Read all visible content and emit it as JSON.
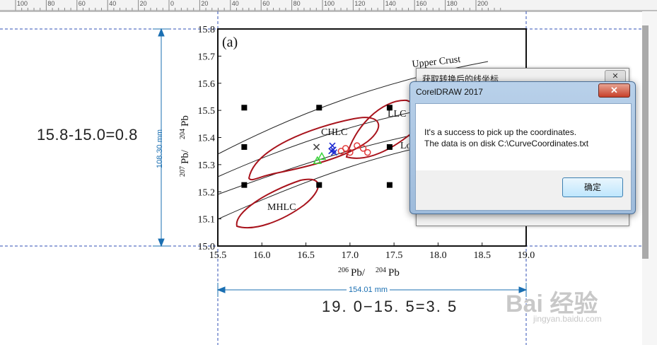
{
  "ruler": {
    "ticks": [
      "100",
      "80",
      "60",
      "40",
      "20",
      "0",
      "20",
      "40",
      "60",
      "80",
      "100",
      "120",
      "140",
      "160",
      "180",
      "200"
    ]
  },
  "chart_data": {
    "type": "scatter",
    "panel_label": "(a)",
    "xlabel_main": "Pb/",
    "xlabel_sup1": "206",
    "xlabel_sup2": "204",
    "xlabel_end": "Pb",
    "ylabel_main": "Pb/",
    "ylabel_sup1": "207",
    "ylabel_sup2": "204",
    "ylabel_end": "Pb",
    "xlim": [
      15.5,
      19.0
    ],
    "ylim": [
      15.0,
      15.8
    ],
    "xticks": [
      "15.5",
      "16.0",
      "16.5",
      "17.0",
      "17.5",
      "18.0",
      "18.5",
      "19.0"
    ],
    "yticks": [
      "15.0",
      "15.1",
      "15.2",
      "15.3",
      "15.4",
      "15.5",
      "15.6",
      "15.7",
      "15.8"
    ],
    "curve_labels": [
      "Upper Crust",
      "LLC",
      "Lo",
      "CHLC",
      "MHLC"
    ],
    "control_points": [
      [
        15.8,
        15.51
      ],
      [
        16.65,
        15.51
      ],
      [
        17.45,
        15.51
      ],
      [
        15.8,
        15.365
      ],
      [
        17.45,
        15.365
      ],
      [
        15.8,
        15.225
      ],
      [
        16.65,
        15.225
      ],
      [
        17.45,
        15.225
      ]
    ],
    "series": [
      {
        "marker": "triangle",
        "color": "#3bd43b",
        "points": [
          [
            16.63,
            15.315
          ],
          [
            16.68,
            15.33
          ]
        ]
      },
      {
        "marker": "x",
        "color": "#1e2bd0",
        "points": [
          [
            16.8,
            15.37
          ],
          [
            16.81,
            15.355
          ],
          [
            16.82,
            15.345
          ],
          [
            16.79,
            15.35
          ]
        ]
      },
      {
        "marker": "circle",
        "color": "#e23a3a",
        "points": [
          [
            16.9,
            15.35
          ],
          [
            16.95,
            15.36
          ],
          [
            17.0,
            15.345
          ],
          [
            17.08,
            15.37
          ],
          [
            17.15,
            15.36
          ],
          [
            17.2,
            15.345
          ]
        ]
      },
      {
        "marker": "x",
        "color": "#444444",
        "points": [
          [
            16.62,
            15.365
          ]
        ]
      }
    ]
  },
  "annotations": {
    "y_calc": "15.8-15.0=0.8",
    "x_calc": "19. 0−15. 5=3. 5",
    "y_dim": "108.30 mm",
    "x_dim": "154.01 mm"
  },
  "back_dialog": {
    "title": "获取转换后的线坐标",
    "close": "✕"
  },
  "dialog": {
    "title": "CorelDRAW 2017",
    "close": "✕",
    "line1": "It's a success to pick up the coordinates.",
    "line2": "The data is on disk C:\\CurveCoordinates.txt",
    "ok": "确定"
  },
  "watermark": {
    "text": "Bai 经验",
    "sub": "jingyan.baidu.com"
  }
}
